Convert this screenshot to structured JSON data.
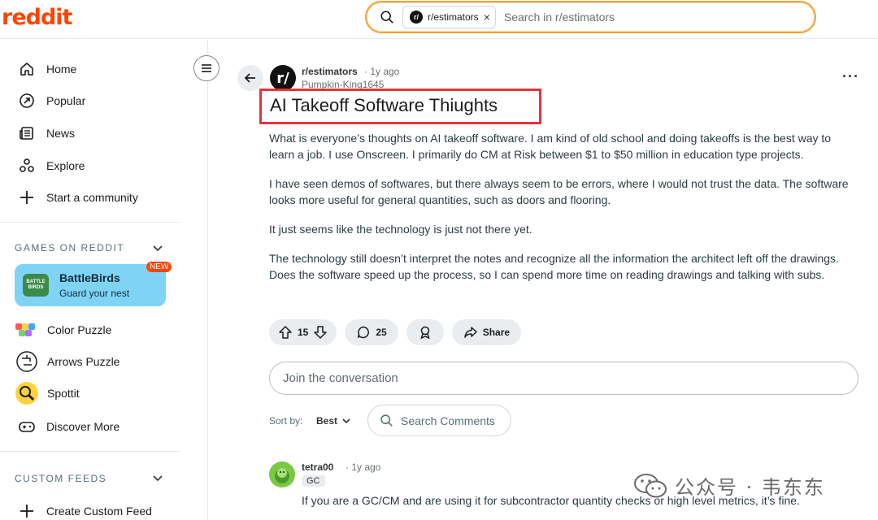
{
  "header": {
    "logo": "reddit",
    "search_chip": "r/estimators",
    "search_chip_icon": "r/",
    "search_placeholder": "Search in r/estimators"
  },
  "sidebar": {
    "nav": [
      {
        "label": "Home",
        "icon": "home-icon"
      },
      {
        "label": "Popular",
        "icon": "popular-icon"
      },
      {
        "label": "News",
        "icon": "news-icon"
      },
      {
        "label": "Explore",
        "icon": "explore-icon"
      },
      {
        "label": "Start a community",
        "icon": "plus-icon"
      }
    ],
    "games_title": "GAMES ON REDDIT",
    "featured_game": {
      "title": "BattleBirds",
      "subtitle": "Guard your nest",
      "badge": "NEW",
      "icon_text": "BATTLE BIRDS"
    },
    "games": [
      {
        "label": "Color Puzzle"
      },
      {
        "label": "Arrows Puzzle"
      },
      {
        "label": "Spottit"
      },
      {
        "label": "Discover More"
      }
    ],
    "custom_feeds_title": "CUSTOM FEEDS",
    "create_feed": "Create Custom Feed"
  },
  "post": {
    "avatar_text": "r/",
    "subreddit": "r/estimators",
    "time": "· 1y ago",
    "author": "Pumpkin-King1645",
    "title": "AI Takeoff Software Thiughts",
    "paragraphs": [
      "What is everyone’s thoughts on AI takeoff software. I am kind of old school and doing takeoffs is the best way to learn a job. I use Onscreen. I primarily do CM at Risk between $1 to $50 million in education type projects.",
      "I have seen demos of softwares, but there always seem to be errors, where I would not trust the data. The software looks more useful for general quantities, such as doors and flooring.",
      "It just seems like the technology is just not there yet.",
      "The technology still doesn’t interpret the notes and recognize all the information the architect left off the drawings. Does the software speed up the process, so I can spend more time on reading drawings and talking with subs."
    ],
    "votes": "15",
    "comments": "25",
    "share": "Share"
  },
  "comments_area": {
    "join_placeholder": "Join the conversation",
    "sort_label": "Sort by:",
    "sort_value": "Best",
    "search_comments": "Search Comments"
  },
  "comment": {
    "author": "tetra00",
    "time": "· 1y ago",
    "flair": "GC",
    "text": "If you are a GC/CM and are using it for subcontractor quantity checks or high level metrics, it’s fine."
  },
  "watermark": "公众号 · 韦东东",
  "colors": {
    "brand": "#ff4500",
    "highlight_box": "#e8323a",
    "game_card": "#7fd4f5"
  }
}
